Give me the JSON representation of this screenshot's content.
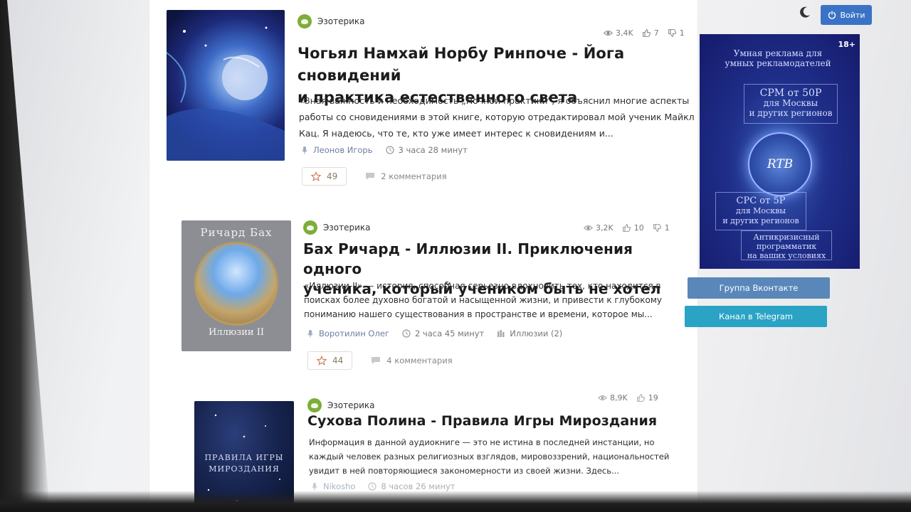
{
  "header": {
    "login_label": "Войти",
    "theme_toggle_icon": "moon-icon"
  },
  "posts": [
    {
      "category": "Эзотерика",
      "views": "3,4K",
      "likes": "7",
      "comments_count": "1",
      "title_line1": "Чогьял Намхай Норбу Ринпоче - Йога сновидений",
      "title_line2": "и практика естественного света",
      "desc_line1": "«Зная важность и необходимость „Ночной практики\", я объяснил многие аспекты",
      "desc_line2": "работы со сновидениями в этой книге, которую отредактировал мой ученик Майкл",
      "desc_line3": "Кац. Я надеюсь, что те, кто уже имеет интерес к сновидениям и...",
      "author": "Леонов Игорь",
      "time": "3 часа 28 минут",
      "favorites": "49",
      "comments_label": "2 комментария"
    },
    {
      "category": "Эзотерика",
      "views": "3,2K",
      "likes": "10",
      "comments_count": "1",
      "title_line1": "Бах Ричард - Иллюзии II. Приключения одного",
      "title_line2": "ученика, который учеником быть не хотел",
      "desc_line1": "«Иллюзии-II» — история, способная серьезно вдохновить тех, кто находится в",
      "desc_line2": "поисках более духовно богатой и насыщенной жизни, и привести к глубокому",
      "desc_line3": "пониманию нашего существования в пространстве и времени, которое мы...",
      "author": "Воротилин Олег",
      "time": "2 часа 45 минут",
      "series": "Иллюзии (2)",
      "favorites": "44",
      "comments_label": "4 комментария",
      "cover_author": "Ричард Бах",
      "cover_title": "Иллюзии II"
    },
    {
      "category": "Эзотерика",
      "views": "8,9K",
      "likes": "19",
      "title_line1": "Сухова Полина - Правила Игры Мироздания",
      "desc_line1": "Информация в данной аудиокниге — это не истина в последней инстанции, но",
      "desc_line2": "каждый человек разных религиозных взглядов, мировоззрений, национальностей",
      "desc_line3": "увидит в ней повторяющиеся закономерности из своей жизни. Здесь...",
      "author": "Nikosho",
      "time": "8 часов 26 минут",
      "cover_title_line1": "ПРАВИЛА ИГРЫ",
      "cover_title_line2": "МИРОЗДАНИЯ"
    }
  ],
  "ad": {
    "age": "18+",
    "line1": "Умная реклама для",
    "line2": "умных рекламодателей",
    "cpm_line1": "CPM от 50Р",
    "cpm_line2": "для Москвы",
    "cpm_line3": "и других регионов",
    "rtb": "RTB",
    "cpc_line1": "CPC от 5Р",
    "cpc_line2": "для Москвы",
    "cpc_line3": "и других регионов",
    "anti_line1": "Антикризисный",
    "anti_line2": "программатик",
    "anti_line3": "на ваших условиях"
  },
  "sidebar": {
    "vk_label": "Группа Вконтакте",
    "tg_label": "Канал в Telegram"
  },
  "colors": {
    "accent": "#3a73c6",
    "vk": "#5a87ba",
    "telegram": "#2aa3c4",
    "category": "#7cae3a"
  }
}
